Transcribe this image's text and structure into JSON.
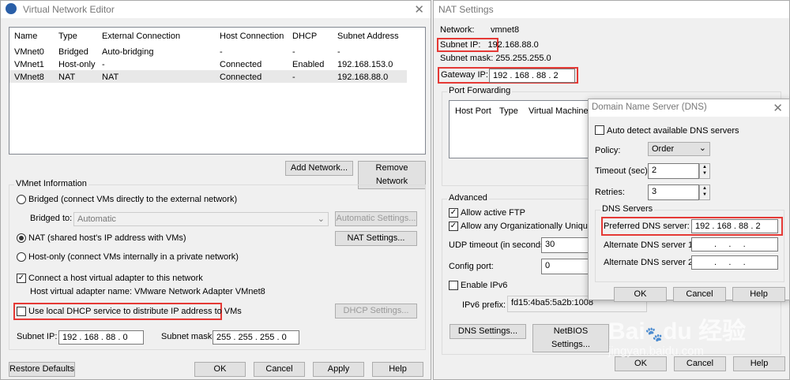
{
  "vne": {
    "title": "Virtual Network Editor",
    "columns": [
      "Name",
      "Type",
      "External Connection",
      "Host Connection",
      "DHCP",
      "Subnet Address"
    ],
    "rows": [
      [
        "VMnet0",
        "Bridged",
        "Auto-bridging",
        "-",
        "-",
        "-"
      ],
      [
        "VMnet1",
        "Host-only",
        "-",
        "Connected",
        "Enabled",
        "192.168.153.0"
      ],
      [
        "VMnet8",
        "NAT",
        "NAT",
        "Connected",
        "-",
        "192.168.88.0"
      ]
    ],
    "add_network": "Add Network...",
    "remove_network": "Remove Network",
    "vmnet_info": "VMnet Information",
    "bridged": "Bridged (connect VMs directly to the external network)",
    "bridged_to": "Bridged to:",
    "bridged_to_value": "Automatic",
    "auto_settings": "Automatic Settings...",
    "nat": "NAT (shared host's IP address with VMs)",
    "nat_settings": "NAT Settings...",
    "hostonly": "Host-only (connect VMs internally in a private network)",
    "connect_adapter": "Connect a host virtual adapter to this network",
    "adapter_name": "Host virtual adapter name: VMware Network Adapter VMnet8",
    "use_dhcp": "Use local DHCP service to distribute IP address to VMs",
    "dhcp_settings": "DHCP Settings...",
    "subnet_ip_label": "Subnet IP:",
    "subnet_ip": "192 . 168 . 88 . 0",
    "subnet_mask_label": "Subnet mask:",
    "subnet_mask": "255 . 255 . 255 . 0",
    "restore": "Restore Defaults",
    "ok": "OK",
    "cancel": "Cancel",
    "apply": "Apply",
    "help": "Help"
  },
  "nat": {
    "title": "NAT Settings",
    "network_label": "Network:",
    "network": "vmnet8",
    "subnet_ip": "Subnet IP:   192.168.88.0",
    "subnet_mask": "Subnet mask: 255.255.255.0",
    "gateway_label": "Gateway IP:",
    "gateway": "192 . 168 . 88 . 2",
    "port_forwarding": "Port Forwarding",
    "pf_columns": [
      "Host Port",
      "Type",
      "Virtual Machine IP"
    ],
    "advanced": "Advanced",
    "allow_ftp": "Allow active FTP",
    "allow_oui": "Allow any Organizationally Unique Id",
    "udp_label": "UDP timeout (in seconds):",
    "udp": "30",
    "config_label": "Config port:",
    "config": "0",
    "ipv6": "Enable IPv6",
    "ipv6_prefix_label": "IPv6 prefix:",
    "ipv6_prefix": "fd15:4ba5:5a2b:1008",
    "dns_settings": "DNS Settings...",
    "netbios": "NetBIOS Settings...",
    "ok": "OK",
    "cancel": "Cancel",
    "help": "Help"
  },
  "dns": {
    "title": "Domain Name Server (DNS)",
    "auto": "Auto detect available DNS servers",
    "policy_label": "Policy:",
    "policy": "Order",
    "timeout_label": "Timeout (sec):",
    "timeout": "2",
    "retries_label": "Retries:",
    "retries": "3",
    "servers": "DNS Servers",
    "preferred_label": "Preferred DNS server:",
    "preferred": "192 . 168 . 88 . 2",
    "alt1_label": "Alternate DNS server 1:",
    "alt1": ".     .     .",
    "alt2_label": "Alternate DNS server 2:",
    "alt2": ".     .     .",
    "ok": "OK",
    "cancel": "Cancel",
    "help": "Help"
  },
  "watermark": "Baidu 经验 jingyan.baidu.com"
}
